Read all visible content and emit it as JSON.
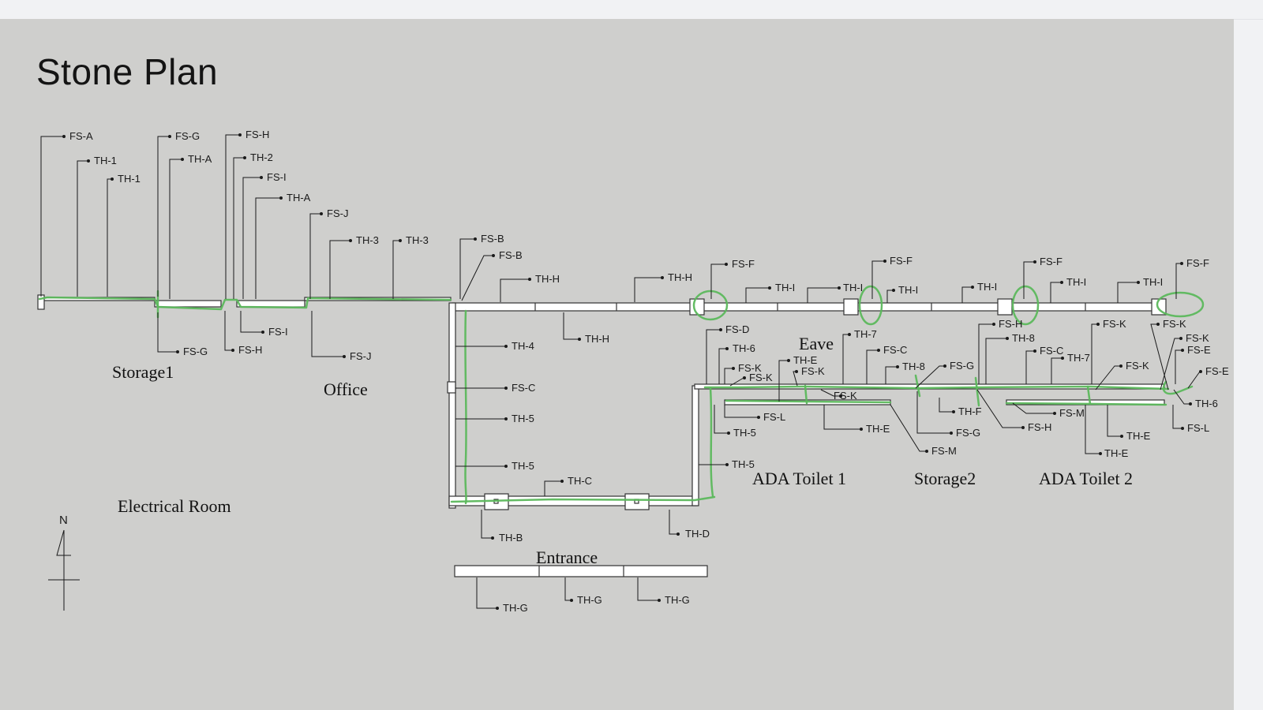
{
  "slide": {
    "title": "Stone Plan"
  },
  "rooms": {
    "storage1": "Storage1",
    "office": "Office",
    "electrical_room": "Electrical Room",
    "entrance": "Entrance",
    "eave": "Eave",
    "ada_toilet_1": "ADA Toilet 1",
    "storage2": "Storage2",
    "ada_toilet_2": "ADA Toilet 2"
  },
  "north_arrow": {
    "label": "N"
  },
  "callouts": {
    "top_left": [
      "FS-A",
      "TH-1",
      "TH-1",
      "FS-G",
      "TH-A",
      "FS-H",
      "TH-2",
      "FS-I",
      "TH-A",
      "FS-J",
      "TH-3",
      "TH-3",
      "FS-B",
      "FS-B",
      "TH-H",
      "TH-H"
    ],
    "below_left": [
      "FS-G",
      "FS-H",
      "FS-I",
      "FS-J",
      "TH-H"
    ],
    "top_right": [
      "FS-F",
      "TH-I",
      "TH-I",
      "FS-F",
      "TH-I",
      "TH-I",
      "FS-F",
      "TH-I",
      "TH-I",
      "FS-F"
    ],
    "office_wall": [
      "TH-4",
      "FS-C",
      "TH-5",
      "TH-5",
      "TH-C",
      "TH-B",
      "TH-D"
    ],
    "entrance": [
      "TH-G",
      "TH-G",
      "TH-G"
    ],
    "toilet_area": [
      "FS-D",
      "TH-6",
      "FS-K",
      "FS-K",
      "TH-E",
      "FS-K",
      "TH-7",
      "FS-C",
      "TH-8",
      "FS-G",
      "FS-K",
      "FS-L",
      "TH-5",
      "TH-5",
      "TH-E",
      "TH-F",
      "FS-G",
      "FS-M"
    ],
    "toilet2_area": [
      "FS-H",
      "TH-8",
      "FS-C",
      "TH-7",
      "FS-K",
      "FS-K",
      "FS-K",
      "FS-E",
      "FS-E",
      "TH-6",
      "FS-M",
      "FS-H",
      "TH-E",
      "TH-E",
      "FS-L",
      "FS-K"
    ]
  },
  "colors": {
    "slide_background": "#cfcfcd",
    "markup_green": "#5cb85c",
    "linework": "#1a1a1a"
  }
}
